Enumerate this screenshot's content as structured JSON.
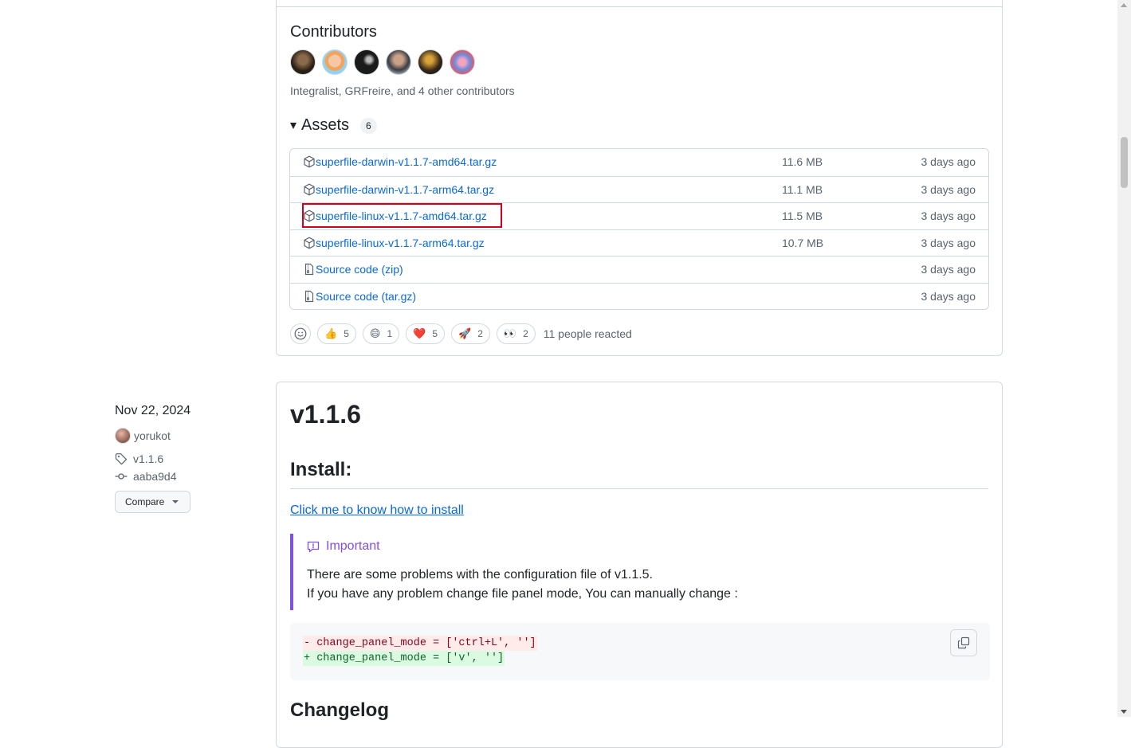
{
  "contributors": {
    "title": "Contributors",
    "summary": "Integralist, GRFreire, and 4 other contributors",
    "avatars": [
      "avatar-1",
      "avatar-2",
      "avatar-3",
      "avatar-4",
      "avatar-5",
      "avatar-6"
    ]
  },
  "assets": {
    "title": "Assets",
    "count": "6",
    "rows": [
      {
        "name": "superfile-darwin-v1.1.7-amd64.tar.gz",
        "size": "11.6 MB",
        "date": "3 days ago",
        "icon": "package-icon"
      },
      {
        "name": "superfile-darwin-v1.1.7-arm64.tar.gz",
        "size": "11.1 MB",
        "date": "3 days ago",
        "icon": "package-icon"
      },
      {
        "name": "superfile-linux-v1.1.7-amd64.tar.gz",
        "size": "11.5 MB",
        "date": "3 days ago",
        "icon": "package-icon"
      },
      {
        "name": "superfile-linux-v1.1.7-arm64.tar.gz",
        "size": "10.7 MB",
        "date": "3 days ago",
        "icon": "package-icon"
      },
      {
        "name": "Source code",
        "suffix": "(zip)",
        "size": "",
        "date": "3 days ago",
        "icon": "file-zip-icon"
      },
      {
        "name": "Source code",
        "suffix": "(tar.gz)",
        "size": "",
        "date": "3 days ago",
        "icon": "file-zip-icon"
      }
    ]
  },
  "reactions": {
    "items": [
      {
        "emoji": "👍",
        "count": "5"
      },
      {
        "emoji": "😄",
        "count": "1"
      },
      {
        "emoji": "❤️",
        "count": "5"
      },
      {
        "emoji": "🚀",
        "count": "2"
      },
      {
        "emoji": "👀",
        "count": "2"
      }
    ],
    "summary": "11 people reacted"
  },
  "release_meta": {
    "date": "Nov 22, 2024",
    "author": "yorukot",
    "tag": "v1.1.6",
    "commit": "aaba9d4",
    "compare_label": "Compare"
  },
  "release": {
    "title": "v1.1.6",
    "install_heading": "Install:",
    "install_link": "Click me to know how to install",
    "alert_title": "Important",
    "alert_line_1": "There are some problems with the configuration file of v1.1.5.",
    "alert_line_2": "If you have any problem change file panel mode, You can manually change :",
    "code_del": "- change_panel_mode = ['ctrl+L', '']",
    "code_add": "+ change_panel_mode = ['v', '']",
    "changelog_heading": "Changelog"
  },
  "colors": {
    "link": "#0969da",
    "muted": "#59636e",
    "border": "#d1d9e0",
    "important": "#8250df",
    "highlight": "#d0021b"
  }
}
